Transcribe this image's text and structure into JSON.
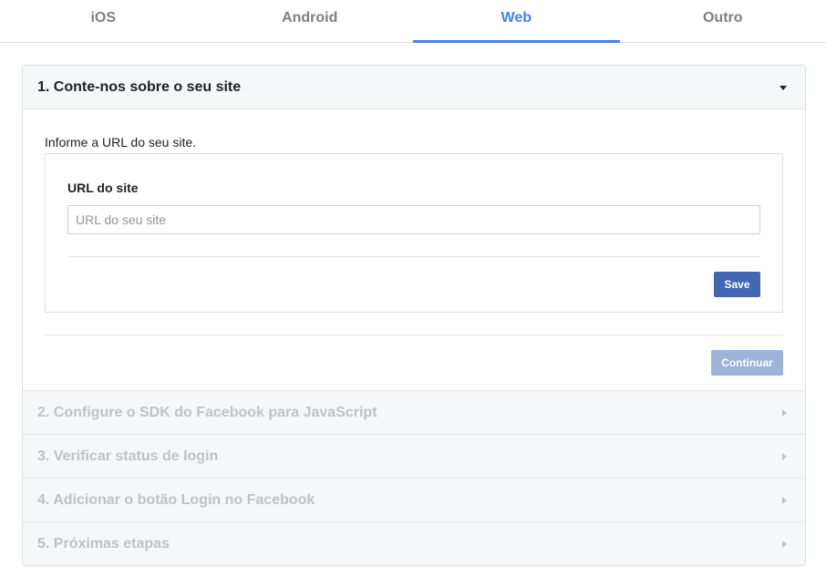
{
  "tabs": [
    {
      "label": "iOS"
    },
    {
      "label": "Android"
    },
    {
      "label": "Web"
    },
    {
      "label": "Outro"
    }
  ],
  "active_tab": "Web",
  "steps": [
    {
      "title": "1. Conte-nos sobre o seu site"
    },
    {
      "title": "2. Configure o SDK do Facebook para JavaScript"
    },
    {
      "title": "3. Verificar status de login"
    },
    {
      "title": "4. Adicionar o botão Login no Facebook"
    },
    {
      "title": "5. Próximas etapas"
    }
  ],
  "step1": {
    "intro": "Informe a URL do seu site.",
    "field_label": "URL do site",
    "input_value": "",
    "input_placeholder": "URL do seu site",
    "save_label": "Save",
    "continue_label": "Continuar"
  },
  "colors": {
    "accent": "#4080ff",
    "save_button": "#4267b2",
    "continue_button_disabled": "#9cb4d8"
  },
  "icons": {
    "expanded": "caret-down-icon",
    "collapsed": "caret-right-icon"
  }
}
